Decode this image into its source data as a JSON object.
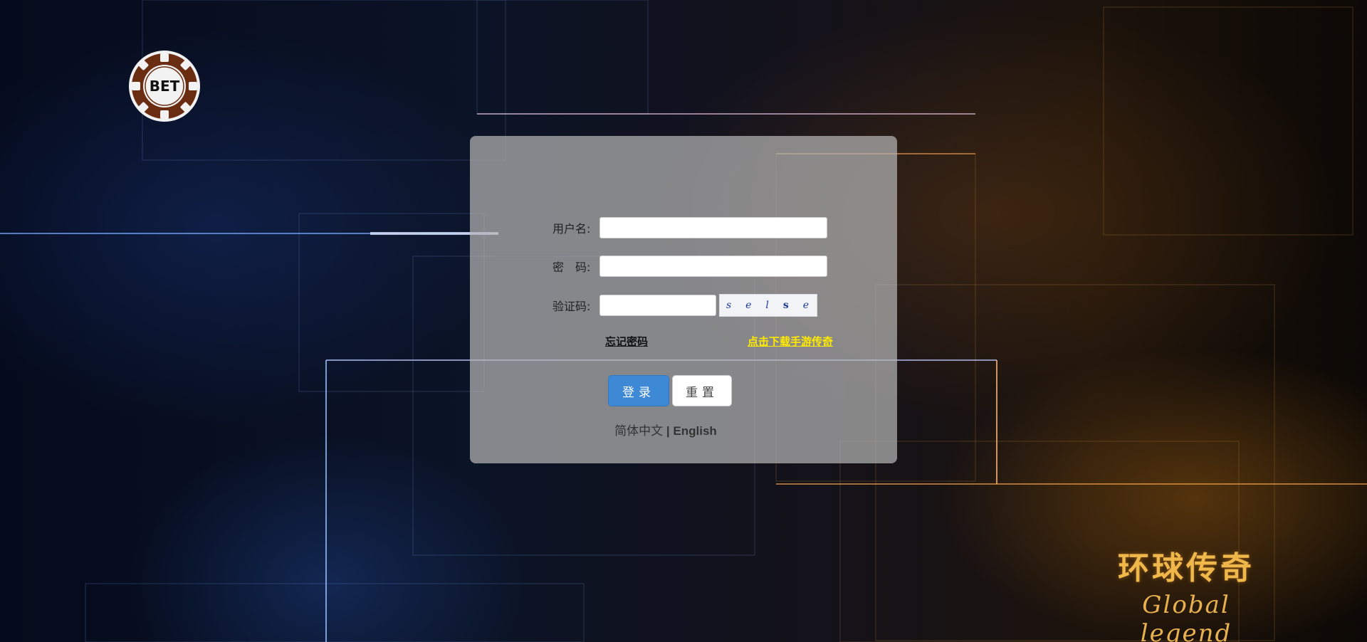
{
  "logo": {
    "text": "BET"
  },
  "form": {
    "username_label": "用户名:",
    "username_value": "",
    "password_label": "密　码:",
    "password_value": "",
    "captcha_label": "验证码:",
    "captcha_value": "",
    "captcha_chars": [
      "s",
      "e",
      "l",
      "s",
      "e"
    ]
  },
  "links": {
    "forgot_password": "忘记密码",
    "download_mobile": "点击下载手游传奇"
  },
  "buttons": {
    "login": "登录",
    "reset": "重置"
  },
  "language": {
    "chinese": "简体中文",
    "separator": "|",
    "english": "English"
  },
  "brand": {
    "chinese": "环球传奇",
    "english": "Global legend"
  },
  "colors": {
    "login_button": "#3d89d6",
    "download_link": "#ffea00",
    "brand_gold": "#f0b84a"
  }
}
